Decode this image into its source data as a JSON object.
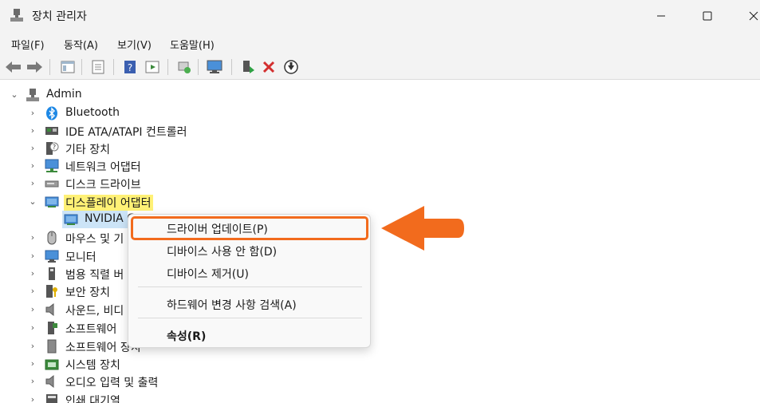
{
  "window": {
    "title": "장치 관리자",
    "min_label": "—",
    "max_label": "☐",
    "close_label": "✕"
  },
  "menu": [
    {
      "label": "파일(F)"
    },
    {
      "label": "동작(A)"
    },
    {
      "label": "보기(V)"
    },
    {
      "label": "도움말(H)"
    }
  ],
  "toolbar": {
    "buttons": [
      "back-icon",
      "forward-icon",
      "console-tree-icon",
      "properties-icon",
      "help-icon",
      "action-pane-icon",
      "scan-hardware-icon",
      "monitor-icon",
      "update-driver-icon",
      "uninstall-icon",
      "disable-icon"
    ]
  },
  "tree": {
    "root": "Admin",
    "items": [
      {
        "label": "Bluetooth",
        "icon": "bluetooth-icon"
      },
      {
        "label": "IDE ATA/ATAPI 컨트롤러",
        "icon": "ide-controller-icon"
      },
      {
        "label": "기타 장치",
        "icon": "other-device-icon"
      },
      {
        "label": "네트워크 어댑터",
        "icon": "network-adapter-icon"
      },
      {
        "label": "디스크 드라이브",
        "icon": "disk-drive-icon"
      },
      {
        "label": "디스플레이 어댑터",
        "icon": "display-adapter-icon"
      },
      {
        "label": "NVIDIA G",
        "icon": "display-adapter-icon"
      },
      {
        "label": "마우스 및 기",
        "icon": "mouse-icon"
      },
      {
        "label": "모니터",
        "icon": "monitor-icon"
      },
      {
        "label": "범용 직렬 버",
        "icon": "usb-icon"
      },
      {
        "label": "보안 장치",
        "icon": "security-device-icon"
      },
      {
        "label": "사운드, 비디",
        "icon": "sound-icon"
      },
      {
        "label": "소프트웨어",
        "icon": "software-component-icon"
      },
      {
        "label": "소프트웨어 장치",
        "icon": "software-device-icon"
      },
      {
        "label": "시스템 장치",
        "icon": "system-device-icon"
      },
      {
        "label": "오디오 입력 및 출력",
        "icon": "audio-io-icon"
      },
      {
        "label": "인쇄 대기열",
        "icon": "print-queue-icon"
      }
    ]
  },
  "context_menu": {
    "update_driver": "드라이버 업데이트(P)",
    "disable_device": "디바이스 사용 안 함(D)",
    "uninstall_device": "디바이스 제거(U)",
    "scan_hardware": "하드웨어 변경 사항 검색(A)",
    "properties": "속성(R)"
  },
  "colors": {
    "highlight": "#fff176",
    "focus_border": "#f26b1d",
    "arrow": "#f26b1d"
  }
}
